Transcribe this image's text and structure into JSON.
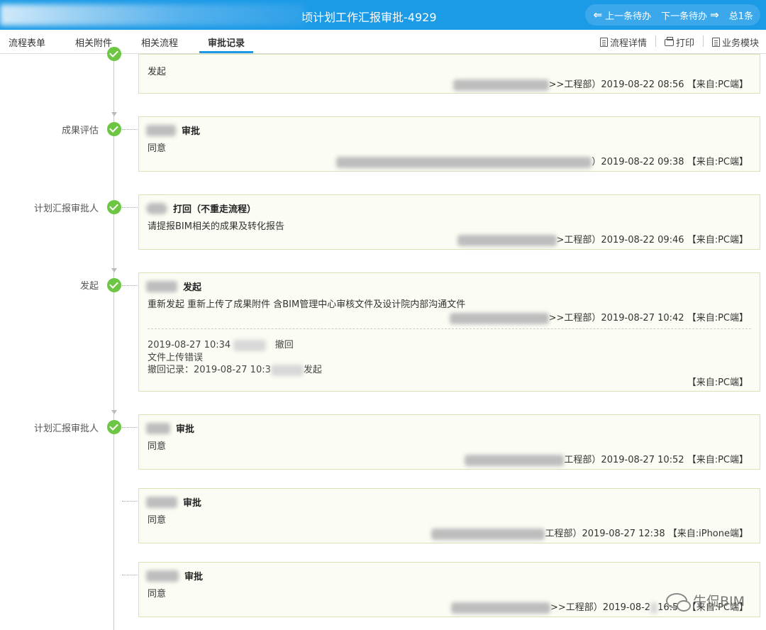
{
  "window": {
    "title": "顷计划工作汇报审批-4929"
  },
  "nav": {
    "prev": "上一条待办",
    "next": "下一条待办",
    "total": "总1条"
  },
  "tabs": [
    "流程表单",
    "相关附件",
    "相关流程",
    "审批记录"
  ],
  "tools": {
    "detail": "流程详情",
    "print": "打印",
    "module": "业务模块"
  },
  "records": [
    {
      "node": "",
      "action": "",
      "comment": "发起",
      "meta": ">>工程部）2019-08-22 08:56 【来自:PC端】"
    },
    {
      "node": "成果评估",
      "action": "审批",
      "comment": "同意",
      "meta": "）2019-08-22 09:38 【来自:PC端】"
    },
    {
      "node": "计划汇报审批人",
      "action": "打回（不重走流程）",
      "comment": "请提报BIM相关的成果及转化报告",
      "meta": ">工程部）2019-08-22 09:46 【来自:PC端】"
    },
    {
      "node": "发起",
      "action": "发起",
      "comment": "重新发起  重新上传了成果附件  含BIM管理中心审核文件及设计院内部沟通文件",
      "meta": ">>工程部）2019-08-27 10:42 【来自:PC端】",
      "withdraw": {
        "time": "2019-08-27 10:34",
        "action": "撤回",
        "reason": "文件上传错误",
        "record_prefix": "撤回记录：2019-08-27 10:3",
        "record_suffix": "发起",
        "source": "【来自:PC端】"
      }
    },
    {
      "node": "计划汇报审批人",
      "action": "审批",
      "comment": "同意",
      "meta": "工程部）2019-08-27 10:52 【来自:PC端】"
    },
    {
      "node": "",
      "action": "审批",
      "comment": "同意",
      "meta": "工程部）2019-08-27 12:38 【来自:iPhone端】"
    },
    {
      "node": "",
      "action": "审批",
      "comment": "同意",
      "meta": ">>工程部）2019-08-2",
      "meta_tail": "16:57 【来自:PC端】"
    }
  ],
  "watermark": "牛侃BIM"
}
